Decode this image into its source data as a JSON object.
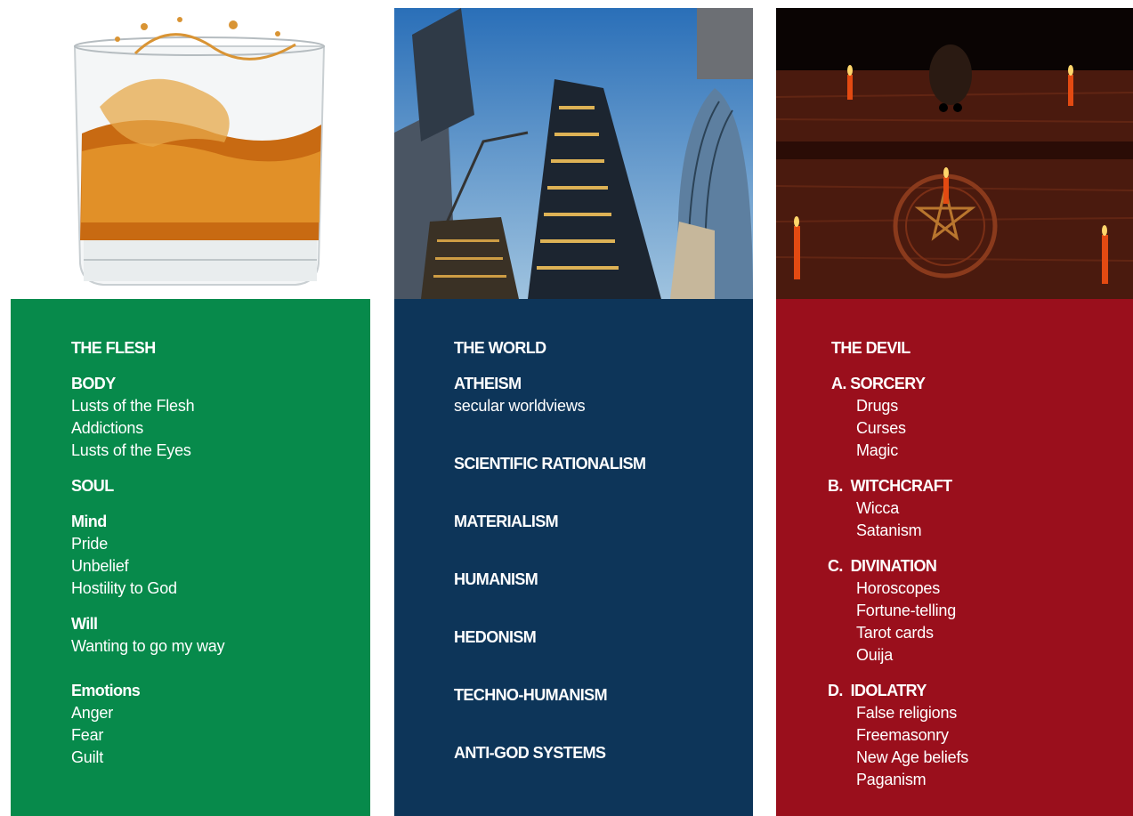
{
  "flesh": {
    "heading": "THE FLESH",
    "body": {
      "label": "BODY",
      "items": [
        "Lusts of the Flesh",
        "Addictions",
        "Lusts of the Eyes"
      ]
    },
    "soul": {
      "label": "SOUL"
    },
    "mind": {
      "label": "Mind",
      "items": [
        "Pride",
        "Unbelief",
        "Hostility to God"
      ]
    },
    "will": {
      "label": "Will",
      "items": [
        "Wanting to go my way"
      ]
    },
    "emotions": {
      "label": "Emotions",
      "items": [
        "Anger",
        "Fear",
        "Guilt"
      ]
    }
  },
  "world": {
    "heading": "THE WORLD",
    "atheism": {
      "label": "ATHEISM",
      "sub": "secular worldviews"
    },
    "items": [
      "SCIENTIFIC RATIONALISM",
      "MATERIALISM",
      "HUMANISM",
      "HEDONISM",
      "TECHNO-HUMANISM",
      "ANTI-GOD SYSTEMS"
    ]
  },
  "devil": {
    "heading": "THE DEVIL",
    "groups": [
      {
        "label": "A. SORCERY",
        "items": [
          "Drugs",
          "Curses",
          "Magic"
        ]
      },
      {
        "label": "B.  WITCHCRAFT",
        "items": [
          "Wicca",
          "Satanism"
        ]
      },
      {
        "label": "C.  DIVINATION",
        "items": [
          "Horoscopes",
          "Fortune-telling",
          "Tarot cards",
          "Ouija"
        ]
      },
      {
        "label": "D.  IDOLATRY",
        "items": [
          "False religions",
          "Freemasonry",
          "New Age beliefs",
          "Paganism"
        ]
      }
    ]
  },
  "colors": {
    "flesh_panel": "#078a4b",
    "world_panel": "#0d3559",
    "devil_panel": "#9a0f1c"
  },
  "images": {
    "flesh": "whiskey-glass-photo",
    "world": "skyscrapers-photo",
    "devil": "occult-altar-photo"
  }
}
